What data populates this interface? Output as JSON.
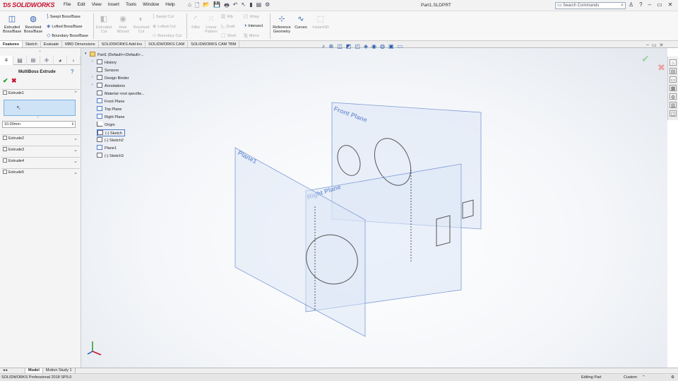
{
  "app": {
    "logo": "SOLIDWORKS",
    "menu": [
      "File",
      "Edit",
      "View",
      "Insert",
      "Tools",
      "Window",
      "Help"
    ],
    "document_title": "Part1.SLDPRT",
    "search_placeholder": "Search Commands"
  },
  "ribbon": {
    "extruded_boss": "Extruded Boss/Base",
    "revolved_boss": "Revolved Boss/Base",
    "swept_boss": "Swept Boss/Base",
    "lofted_boss": "Lofted Boss/Base",
    "boundary_boss": "Boundary Boss/Base",
    "extruded_cut": "Extruded Cut",
    "hole_wizard": "Hole Wizard",
    "revolved_cut": "Revolved Cut",
    "swept_cut": "Swept Cut",
    "lofted_cut": "Lofted Cut",
    "boundary_cut": "Boundary Cut",
    "fillet": "Fillet",
    "linear_pattern": "Linear Pattern",
    "rib": "Rib",
    "draft": "Draft",
    "shell": "Shell",
    "wrap": "Wrap",
    "intersect": "Intersect",
    "mirror": "Mirror",
    "reference_geometry": "Reference Geometry",
    "curves": "Curves",
    "instant3d": "Instant3D"
  },
  "command_tabs": [
    "Features",
    "Sketch",
    "Evaluate",
    "MBD Dimensions",
    "SOLIDWORKS Add-Ins",
    "SOLIDWORKS CAM",
    "SOLIDWORKS CAM TBM"
  ],
  "property_manager": {
    "title": "MultiBoss Extrude",
    "groups": {
      "extrude1_top": "Extrude1",
      "extrude2": "Extrude2",
      "extrude3": "Extrude3",
      "extrude4": "Extrude4",
      "extrude5": "Extrude5"
    },
    "depth_value": "10.00mm"
  },
  "feature_tree": {
    "part": "Part1 (Default<<Default>...",
    "history": "History",
    "sensors": "Sensors",
    "design_binder": "Design Binder",
    "annotations": "Annotations",
    "material": "Material <not specifie...",
    "front_plane": "Front Plane",
    "top_plane": "Top Plane",
    "right_plane": "Right Plane",
    "origin": "Origin",
    "sketch1": "(-) Sketch",
    "sketch2": "(-) Sketch2",
    "plane1": "Plane1",
    "sketch3": "(-) Sketch3"
  },
  "viewport": {
    "plane_front_label": "Front Plane",
    "plane_right_label": "Right Plane",
    "plane_1_label": "Plane1"
  },
  "model_tabs": [
    "Model",
    "Motion Study 1"
  ],
  "status": {
    "product": "SOLIDWORKS Professional 2018 SP5.0",
    "mode": "Editing Part",
    "units": "Custom"
  },
  "colors": {
    "brand_red": "#c8102e",
    "accent_blue": "#2a5db0",
    "plane_fill": "#dbe6f6",
    "plane_edge": "#7d9bd6",
    "selection_fill": "#cfe3f7"
  }
}
